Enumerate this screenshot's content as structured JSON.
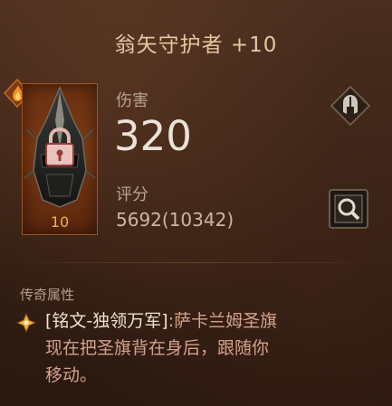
{
  "item": {
    "title": "翁矢守护者 +10",
    "level": "10"
  },
  "stats": {
    "damage_label": "伤害",
    "damage_value": "320",
    "score_label": "评分",
    "score_value": "5692(10342)"
  },
  "legendary": {
    "header": "传奇属性",
    "name": "[铭文-独领万军]",
    "text_line1": ":萨卡兰姆圣旗",
    "text_line2": "现在把圣旗背在身后，跟随你",
    "text_line3": "移动。"
  },
  "icons": {
    "flame": "flame-icon",
    "lock": "lock-icon",
    "helm": "helm-icon",
    "magnify": "magnify-icon",
    "legendary": "diamond-star-icon"
  },
  "colors": {
    "title": "#e3c7a3",
    "legendary_text": "#d5a18b",
    "level": "#e8b348",
    "slot_bg": "#7c3a14"
  }
}
